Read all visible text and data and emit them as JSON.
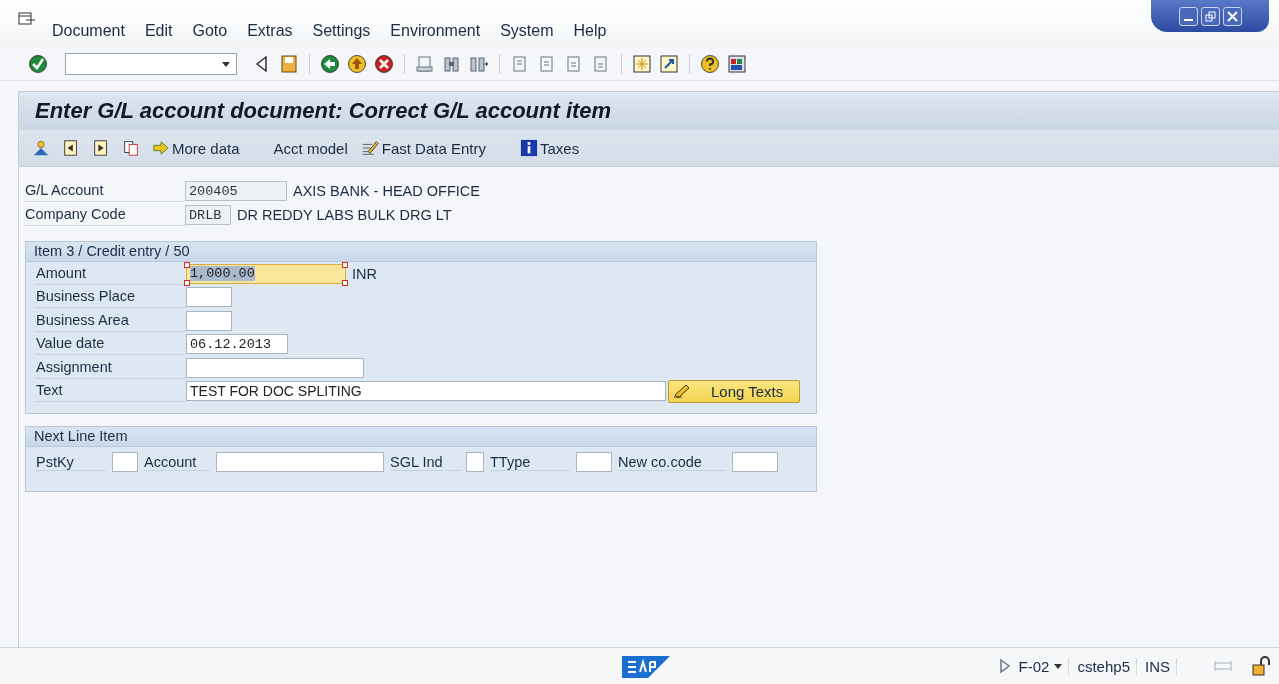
{
  "menu": [
    "Document",
    "Edit",
    "Goto",
    "Extras",
    "Settings",
    "Environment",
    "System",
    "Help"
  ],
  "title": "Enter G/L account document: Correct G/L account item",
  "app_toolbar": [
    {
      "kind": "icon"
    },
    {
      "kind": "icon"
    },
    {
      "kind": "icon"
    },
    {
      "kind": "icon"
    },
    {
      "kind": "labeled",
      "label": "More data"
    },
    {
      "kind": "text",
      "label": "Acct model"
    },
    {
      "kind": "labeled",
      "label": "Fast Data Entry"
    },
    {
      "kind": "labeled",
      "label": "Taxes"
    }
  ],
  "header_fields": [
    {
      "label": "G/L Account",
      "value": "200405",
      "description": "AXIS BANK - HEAD OFFICE"
    },
    {
      "label": "Company Code",
      "value": "DRLB",
      "description": "DR REDDY LABS BULK DRG LT"
    }
  ],
  "item_group": {
    "title": "Item 3 / Credit entry / 50",
    "fields": [
      {
        "label": "Amount",
        "value": "1,000.00",
        "focused": true,
        "unit": "INR"
      },
      {
        "label": "Business Place",
        "focused": false
      },
      {
        "label": "Business Area",
        "focused": false
      },
      {
        "label": "Value date",
        "value": "06.12.2013",
        "focused": false
      },
      {
        "label": "Assignment",
        "focused": false
      },
      {
        "label": "Text",
        "value": "TEST FOR DOC SPLITING",
        "focused": false,
        "button": "Long Texts"
      }
    ]
  },
  "next_line_item": {
    "title": "Next Line Item",
    "fields": [
      "PstKy",
      "Account",
      "SGL Ind",
      "TType",
      "New co.code"
    ]
  },
  "status_bar": {
    "transaction": "F-02",
    "user": "cstehp5",
    "mode": "INS"
  }
}
